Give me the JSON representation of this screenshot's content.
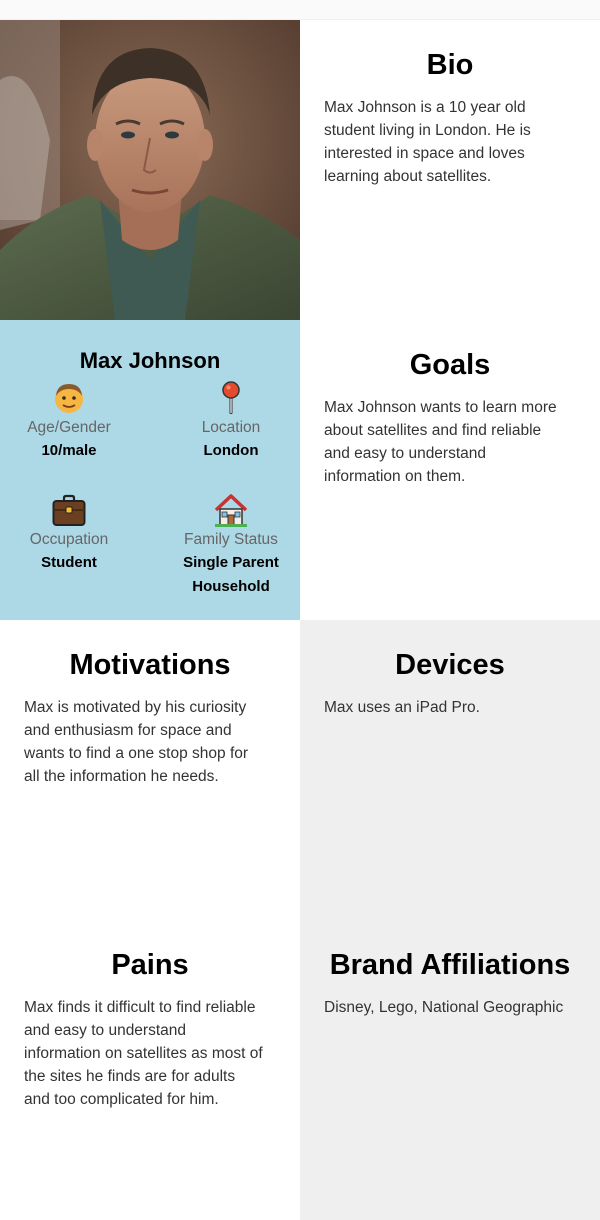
{
  "profile": {
    "name": "Max Johnson",
    "photo_alt": "Portrait of Max Johnson",
    "fields": [
      {
        "icon": "boy-face-icon",
        "label": "Age/Gender",
        "value": "10/male"
      },
      {
        "icon": "map-pin-icon",
        "label": "Location",
        "value": "London"
      },
      {
        "icon": "briefcase-icon",
        "label": "Occupation",
        "value": "Student"
      },
      {
        "icon": "house-icon",
        "label": "Family Status",
        "value_line1": "Single Parent",
        "value_line2": "Household"
      }
    ]
  },
  "bio": {
    "title": "Bio",
    "lines": [
      "Max Johnson is a 10 year old",
      "student living in London. He is",
      "interested in space and loves",
      "learning about satellites."
    ]
  },
  "goals": {
    "title": "Goals",
    "lines": [
      "Max Johnson wants to learn more",
      "about satellites and find reliable",
      "and easy to understand",
      "information on them."
    ]
  },
  "motivations": {
    "title": "Motivations",
    "lines": [
      "Max is motivated by his curiosity",
      "and enthusiasm for space and",
      "wants to find a one stop shop for",
      "all the information he needs."
    ]
  },
  "devices": {
    "title": "Devices",
    "lines": [
      "Max uses an iPad Pro."
    ]
  },
  "pains": {
    "title": "Pains",
    "lines": [
      "Max finds it difficult to find reliable",
      "and easy to understand",
      "information on satellites as most of",
      "the sites he finds are for adults",
      "and too complicated for him."
    ]
  },
  "brands": {
    "title": "Brand Affiliations",
    "lines": [
      "Disney, Lego, National Geographic"
    ]
  },
  "colors": {
    "profile_bg": "#add8e6",
    "panel_gray": "#efefef",
    "body_text": "#333333",
    "label_text": "#666666"
  }
}
